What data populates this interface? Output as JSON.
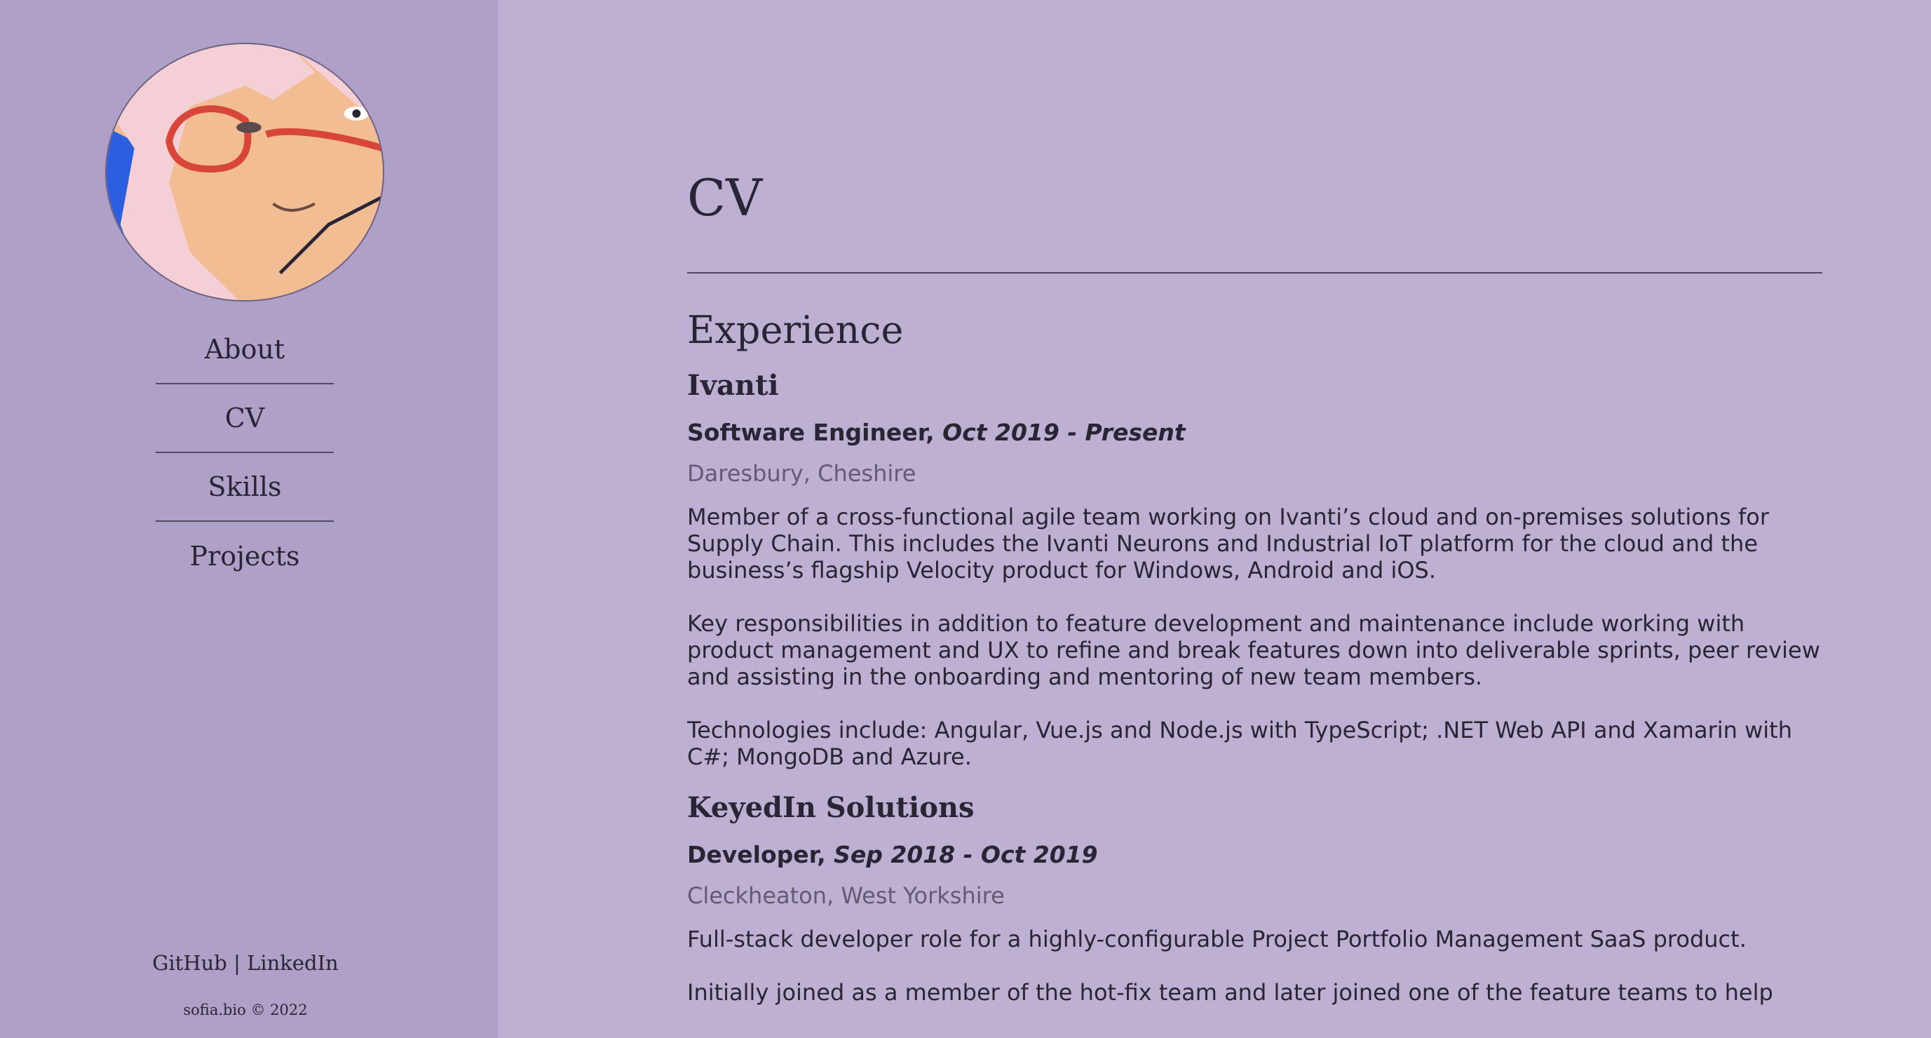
{
  "sidebar": {
    "nav": [
      "About",
      "CV",
      "Skills",
      "Projects"
    ],
    "footer": {
      "github": "GitHub",
      "separator": " | ",
      "linkedin": "LinkedIn",
      "copyright": "sofia.bio © 2022"
    }
  },
  "main": {
    "title": "CV",
    "section_title": "Experience",
    "jobs": [
      {
        "company": "Ivanti",
        "role": "Software Engineer,",
        "dates": "Oct 2019 - Present",
        "location": "Daresbury, Cheshire",
        "paragraphs": [
          "Member of a cross-functional agile team working on Ivanti’s cloud and on-premises solutions for Supply Chain. This includes the Ivanti Neurons and Industrial IoT platform for the cloud and the business’s flagship Velocity product for Windows, Android and iOS.",
          "Key responsibilities in addition to feature development and maintenance include working with product management and UX to refine and break features down into deliverable sprints, peer review and assisting in the onboarding and mentoring of new team members.",
          "Technologies include: Angular, Vue.js and Node.js with TypeScript; .NET Web API and Xamarin with C#; MongoDB and Azure."
        ]
      },
      {
        "company": "KeyedIn Solutions",
        "role": "Developer,",
        "dates": "Sep 2018 - Oct 2019",
        "location": "Cleckheaton, West Yorkshire",
        "paragraphs": [
          "Full-stack developer role for a highly-configurable Project Portfolio Management SaaS product.",
          "Initially joined as a member of the hot-fix team and later joined one of the feature teams to help"
        ]
      }
    ]
  },
  "colors": {
    "page_background": "#bdb0d2",
    "sidebar_background": "#aea0c6",
    "text": "#2a2535",
    "muted_text": "#625b73"
  },
  "icons": {
    "avatar": "avatar-illustration"
  }
}
